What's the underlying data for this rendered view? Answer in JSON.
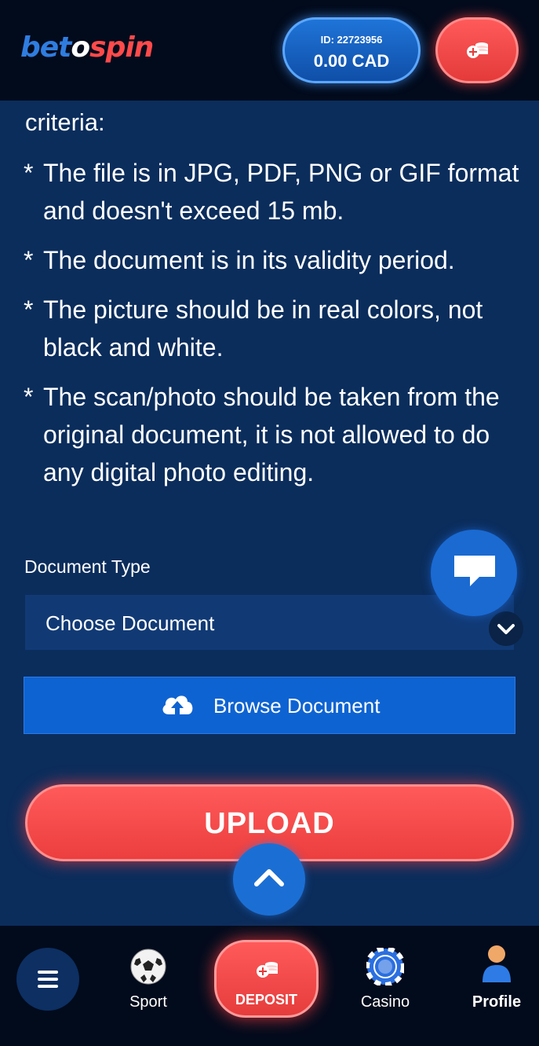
{
  "header": {
    "logo_bet": "bet",
    "logo_o": "o",
    "logo_spin": "spin",
    "user_id": "ID: 22723956",
    "balance": "0.00 CAD",
    "deposit_icon": "coins-plus-icon"
  },
  "content": {
    "criteria_heading": "criteria:",
    "rules": [
      "The file is in JPG, PDF, PNG or GIF format and doesn't exceed 15 mb.",
      "The document is in its validity period.",
      "The picture should be in real colors, not black and white.",
      "The scan/photo should be taken from the original document, it is not allowed to do any digital photo editing."
    ],
    "bullet": "*",
    "document_type_label": "Document Type",
    "document_select_value": "Choose Document",
    "browse_label": "Browse Document",
    "upload_label": "UPLOAD"
  },
  "bottom_nav": {
    "sport": "Sport",
    "deposit": "DEPOSIT",
    "casino": "Casino",
    "profile": "Profile"
  },
  "colors": {
    "background": "#0b2d5c",
    "header": "#020b1c",
    "primary_blue": "#0e63d2",
    "accent_red": "#ff4a4a"
  }
}
